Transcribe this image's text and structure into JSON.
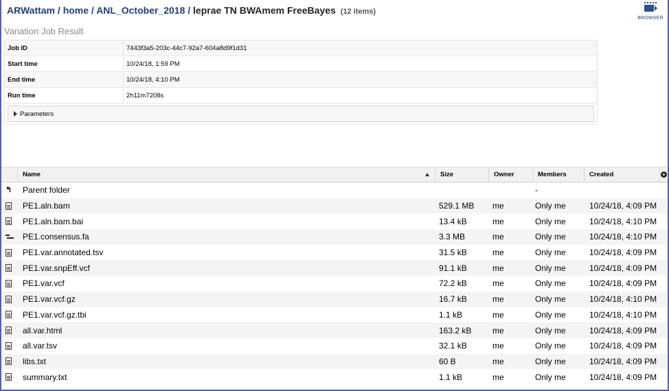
{
  "breadcrumb": {
    "items": [
      "ARWattam",
      "home",
      "ANL_October_2018"
    ],
    "separator": "/",
    "current": "leprae TN BWAmem FreeBayes",
    "count": "(12 items)"
  },
  "browser_button": {
    "label": "BROWSER",
    "icon": "browser-icon"
  },
  "section_title": "Variation Job Result",
  "job_info": [
    {
      "key": "Job ID",
      "value": "7443f3a5-203c-44c7-92a7-604a8d9f1d31"
    },
    {
      "key": "Start time",
      "value": "10/24/18, 1:59 PM"
    },
    {
      "key": "End time",
      "value": "10/24/18, 4:10 PM"
    },
    {
      "key": "Run time",
      "value": "2h11m7208s"
    }
  ],
  "parameters_label": "Parameters",
  "grid": {
    "columns": {
      "name": "Name",
      "size": "Size",
      "owner": "Owner",
      "members": "Members",
      "created": "Created"
    },
    "parent": {
      "name": "Parent folder",
      "members": "-"
    },
    "rows": [
      {
        "icon": "document-icon",
        "name": "PE1.aln.bam",
        "size": "529.1 MB",
        "owner": "me",
        "members": "Only me",
        "created": "10/24/18, 4:09 PM"
      },
      {
        "icon": "document-icon",
        "name": "PE1.aln.bam.bai",
        "size": "13.4 kB",
        "owner": "me",
        "members": "Only me",
        "created": "10/24/18, 4:10 PM"
      },
      {
        "icon": "sequence-icon",
        "name": "PE1.consensus.fa",
        "size": "3.3 MB",
        "owner": "me",
        "members": "Only me",
        "created": "10/24/18, 4:10 PM"
      },
      {
        "icon": "document-icon",
        "name": "PE1.var.annotated.tsv",
        "size": "31.5 kB",
        "owner": "me",
        "members": "Only me",
        "created": "10/24/18, 4:09 PM"
      },
      {
        "icon": "document-icon",
        "name": "PE1.var.snpEff.vcf",
        "size": "91.1 kB",
        "owner": "me",
        "members": "Only me",
        "created": "10/24/18, 4:09 PM"
      },
      {
        "icon": "document-icon",
        "name": "PE1.var.vcf",
        "size": "72.2 kB",
        "owner": "me",
        "members": "Only me",
        "created": "10/24/18, 4:09 PM"
      },
      {
        "icon": "document-icon",
        "name": "PE1.var.vcf.gz",
        "size": "16.7 kB",
        "owner": "me",
        "members": "Only me",
        "created": "10/24/18, 4:10 PM"
      },
      {
        "icon": "document-icon",
        "name": "PE1.var.vcf.gz.tbi",
        "size": "1.1 kB",
        "owner": "me",
        "members": "Only me",
        "created": "10/24/18, 4:10 PM"
      },
      {
        "icon": "document-icon",
        "name": "all.var.html",
        "size": "163.2 kB",
        "owner": "me",
        "members": "Only me",
        "created": "10/24/18, 4:09 PM"
      },
      {
        "icon": "document-icon",
        "name": "all.var.tsv",
        "size": "32.1 kB",
        "owner": "me",
        "members": "Only me",
        "created": "10/24/18, 4:09 PM"
      },
      {
        "icon": "document-icon",
        "name": "libs.txt",
        "size": "60 B",
        "owner": "me",
        "members": "Only me",
        "created": "10/24/18, 4:09 PM"
      },
      {
        "icon": "document-icon",
        "name": "summary.txt",
        "size": "1.1 kB",
        "owner": "me",
        "members": "Only me",
        "created": "10/24/18, 4:09 PM"
      }
    ]
  }
}
